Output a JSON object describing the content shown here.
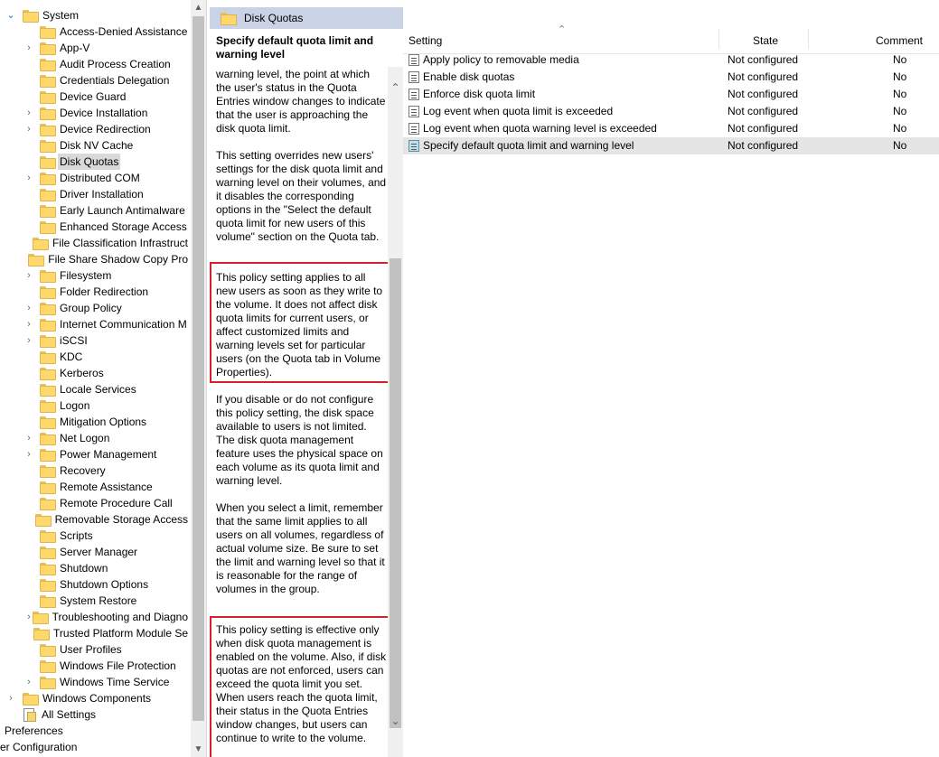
{
  "tree": {
    "root": {
      "label": "System",
      "expanded": true
    },
    "items": [
      {
        "label": "Access-Denied Assistance",
        "expandable": false
      },
      {
        "label": "App-V",
        "expandable": true
      },
      {
        "label": "Audit Process Creation",
        "expandable": false
      },
      {
        "label": "Credentials Delegation",
        "expandable": false
      },
      {
        "label": "Device Guard",
        "expandable": false
      },
      {
        "label": "Device Installation",
        "expandable": true
      },
      {
        "label": "Device Redirection",
        "expandable": true
      },
      {
        "label": "Disk NV Cache",
        "expandable": false
      },
      {
        "label": "Disk Quotas",
        "expandable": false,
        "selected": true
      },
      {
        "label": "Distributed COM",
        "expandable": true
      },
      {
        "label": "Driver Installation",
        "expandable": false
      },
      {
        "label": "Early Launch Antimalware",
        "expandable": false
      },
      {
        "label": "Enhanced Storage Access",
        "expandable": false
      },
      {
        "label": "File Classification Infrastruct",
        "expandable": false
      },
      {
        "label": "File Share Shadow Copy Pro",
        "expandable": false
      },
      {
        "label": "Filesystem",
        "expandable": true
      },
      {
        "label": "Folder Redirection",
        "expandable": false
      },
      {
        "label": "Group Policy",
        "expandable": true
      },
      {
        "label": "Internet Communication M",
        "expandable": true
      },
      {
        "label": "iSCSI",
        "expandable": true
      },
      {
        "label": "KDC",
        "expandable": false
      },
      {
        "label": "Kerberos",
        "expandable": false
      },
      {
        "label": "Locale Services",
        "expandable": false
      },
      {
        "label": "Logon",
        "expandable": false
      },
      {
        "label": "Mitigation Options",
        "expandable": false
      },
      {
        "label": "Net Logon",
        "expandable": true
      },
      {
        "label": "Power Management",
        "expandable": true
      },
      {
        "label": "Recovery",
        "expandable": false
      },
      {
        "label": "Remote Assistance",
        "expandable": false
      },
      {
        "label": "Remote Procedure Call",
        "expandable": false
      },
      {
        "label": "Removable Storage Access",
        "expandable": false
      },
      {
        "label": "Scripts",
        "expandable": false
      },
      {
        "label": "Server Manager",
        "expandable": false
      },
      {
        "label": "Shutdown",
        "expandable": false
      },
      {
        "label": "Shutdown Options",
        "expandable": false
      },
      {
        "label": "System Restore",
        "expandable": false
      },
      {
        "label": "Troubleshooting and Diagno",
        "expandable": true
      },
      {
        "label": "Trusted Platform Module Se",
        "expandable": false
      },
      {
        "label": "User Profiles",
        "expandable": false
      },
      {
        "label": "Windows File Protection",
        "expandable": false
      },
      {
        "label": "Windows Time Service",
        "expandable": true
      }
    ],
    "windows_components": "Windows Components",
    "all_settings": "All Settings",
    "preferences": "Preferences",
    "user_configuration": "er Configuration"
  },
  "description": {
    "header": "Disk Quotas",
    "title": "Specify default quota limit and warning level",
    "paragraphs": [
      "warning level, the point at which the user's status in the Quota Entries window changes to indicate that the user is approaching the disk quota limit.",
      "This setting overrides new users' settings for the disk quota limit and warning level on their volumes, and it disables the corresponding options in the \"Select the default quota limit for new users of this volume\" section on the Quota tab.",
      "This policy setting applies to all new users as soon as they write to the volume. It does not affect disk quota limits for current users, or affect customized limits and warning levels set for particular users (on the Quota tab in Volume Properties).",
      "If you disable or do not configure this policy setting, the disk space available to users is not limited. The disk quota management feature uses the physical space on each volume as its quota limit and warning level.",
      "When you select a limit, remember that the same limit applies to all users on all volumes, regardless of actual volume size. Be sure to set the limit and warning level so that it is reasonable for the range of volumes in the group.",
      "This policy setting is effective only when disk quota management is enabled on the volume. Also, if disk quotas are not enforced, users can exceed the quota limit you set. When users reach the quota limit, their status in the Quota Entries window changes, but users can continue to write to the volume."
    ]
  },
  "list": {
    "columns": {
      "setting": "Setting",
      "state": "State",
      "comment": "Comment"
    },
    "rows": [
      {
        "setting": "Apply policy to removable media",
        "state": "Not configured",
        "comment": "No"
      },
      {
        "setting": "Enable disk quotas",
        "state": "Not configured",
        "comment": "No"
      },
      {
        "setting": "Enforce disk quota limit",
        "state": "Not configured",
        "comment": "No"
      },
      {
        "setting": "Log event when quota limit is exceeded",
        "state": "Not configured",
        "comment": "No"
      },
      {
        "setting": "Log event when quota warning level is exceeded",
        "state": "Not configured",
        "comment": "No"
      },
      {
        "setting": "Specify default quota limit and warning level",
        "state": "Not configured",
        "comment": "No",
        "selected": true
      }
    ]
  },
  "icons": {
    "chevron_expanded": "chevron-down-icon",
    "chevron_collapsed": "chevron-right-icon",
    "folder": "folder-icon",
    "policy": "policy-setting-icon",
    "all_settings": "all-settings-icon"
  },
  "colors": {
    "highlight_box": "#d4202a",
    "description_header": "#c9d3e5",
    "selection": "#e5e5e5"
  }
}
